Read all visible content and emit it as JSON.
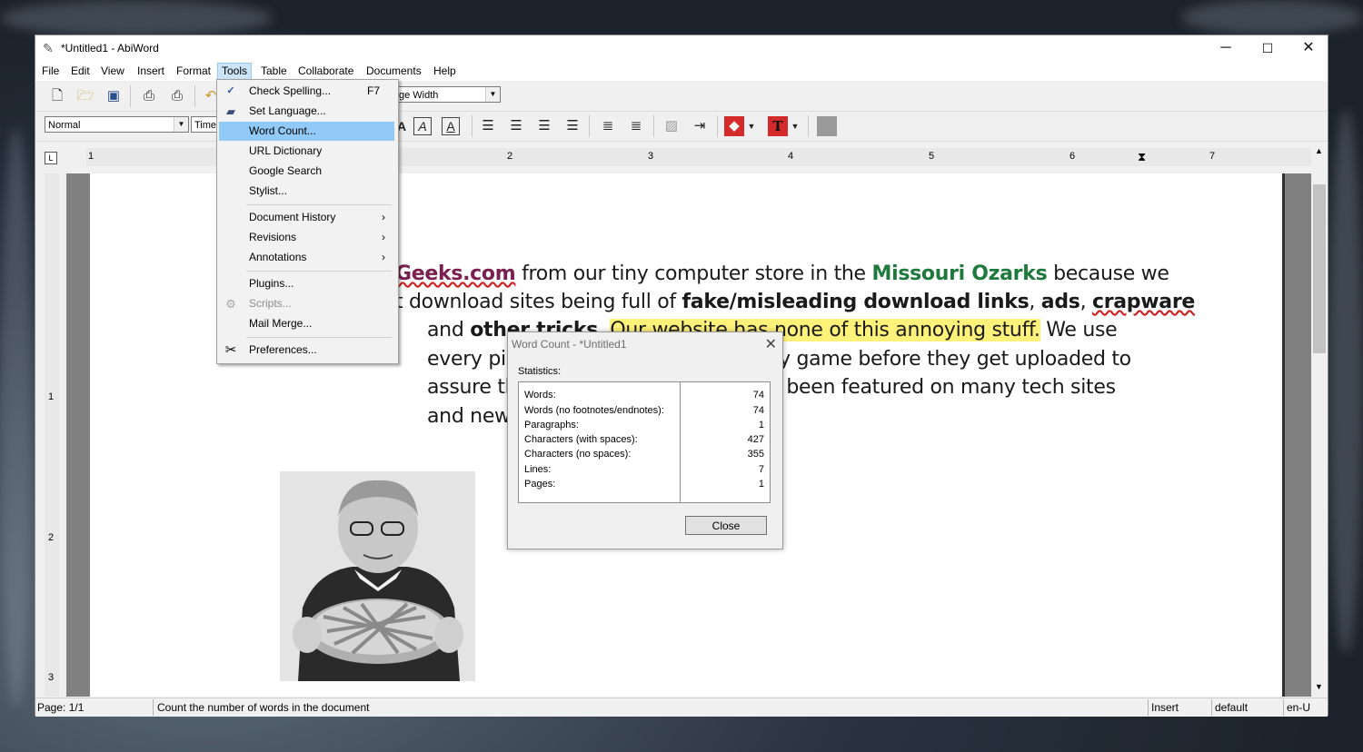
{
  "window": {
    "title": "*Untitled1 - AbiWord",
    "minimize": "─",
    "maximize": "☐",
    "close": "✕"
  },
  "menubar": [
    "File",
    "Edit",
    "View",
    "Insert",
    "Format",
    "Tools",
    "Table",
    "Collaborate",
    "Documents",
    "Help"
  ],
  "toolbar": {
    "zoom_value": "ge Width",
    "style_value": "Normal",
    "font_value": "Times"
  },
  "ruler": {
    "h_numbers": [
      "1",
      "2",
      "3",
      "4",
      "5",
      "6",
      "7"
    ],
    "v_numbers": [
      "1",
      "2",
      "3"
    ],
    "corner": "L"
  },
  "document": {
    "line1": {
      "a": "Geeks.com",
      "b": " from our tiny computer store in the ",
      "c": "Missouri Ozarks",
      "d": " because we"
    },
    "line2": {
      "a": "t download sites being full of ",
      "b": "fake/misleading download links",
      "c": ", ",
      "d": "ads",
      "e": ", ",
      "f": "crapware"
    },
    "line3": {
      "a": "and ",
      "b": "other tricks",
      "c": ". ",
      "d": "Our website has none of this annoying stuff.",
      "e": " We use"
    },
    "line4": {
      "a": "every pie",
      "b": "y game before they get uploaded to"
    },
    "line5": {
      "a": "assure th",
      "b": "been featured on many tech sites"
    },
    "line6": {
      "a": "and new"
    }
  },
  "tools_menu": {
    "items": [
      {
        "label": "Check Spelling...",
        "shortcut": "F7",
        "icon": "spellcheck-icon"
      },
      {
        "label": "Set Language...",
        "icon": "language-book-icon"
      },
      {
        "label": "Word Count...",
        "highlighted": true
      },
      {
        "label": "URL Dictionary"
      },
      {
        "label": "Google Search"
      },
      {
        "label": "Stylist..."
      },
      {
        "label": "Document History",
        "submenu": true
      },
      {
        "label": "Revisions",
        "submenu": true
      },
      {
        "label": "Annotations",
        "submenu": true
      },
      {
        "label": "Plugins..."
      },
      {
        "label": "Scripts...",
        "disabled": true,
        "icon": "gear-icon"
      },
      {
        "label": "Mail Merge..."
      },
      {
        "label": "Preferences...",
        "icon": "scissors-icon"
      }
    ],
    "submenu_arrow": "›"
  },
  "word_count_dialog": {
    "title": "Word Count - *Untitled1",
    "section": "Statistics:",
    "stats": [
      {
        "label": "Words:",
        "value": "74"
      },
      {
        "label": "Words (no footnotes/endnotes):",
        "value": "74"
      },
      {
        "label": "Paragraphs:",
        "value": "1"
      },
      {
        "label": "Characters (with spaces):",
        "value": "427"
      },
      {
        "label": "Characters (no spaces):",
        "value": "355"
      },
      {
        "label": "Lines:",
        "value": "7"
      },
      {
        "label": "Pages:",
        "value": "1"
      }
    ],
    "close_button": "Close"
  },
  "statusbar": {
    "page": "Page: 1/1",
    "hint": "Count the number of words in the document",
    "mode": "Insert",
    "style": "default",
    "lang": "en-U"
  },
  "colors": {
    "highlight": "#fff27a",
    "menu_hover": "#91c9f7",
    "link_purple": "#7a1f4f",
    "ozarks_green": "#1e7a3c"
  }
}
